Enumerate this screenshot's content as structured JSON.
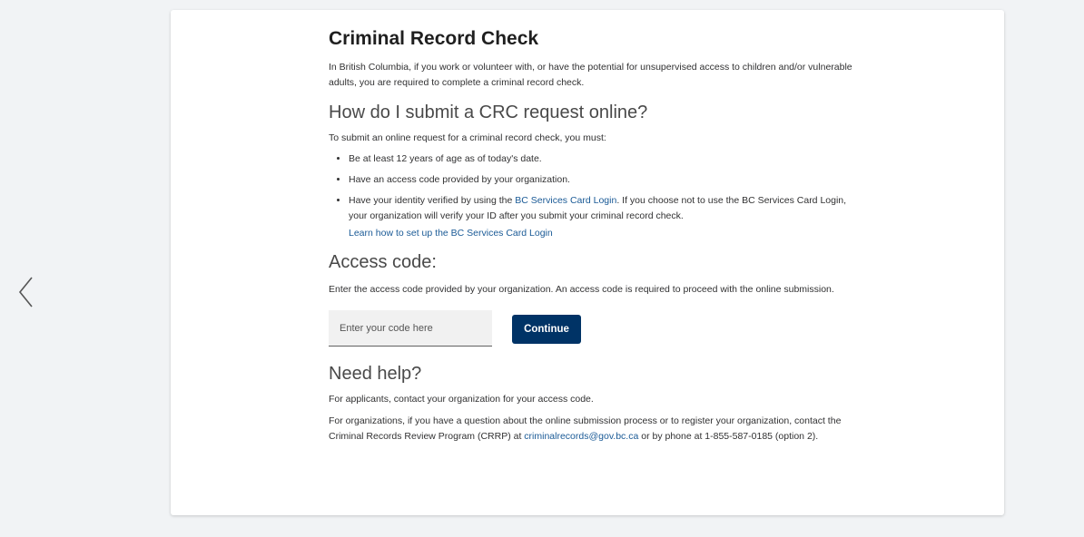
{
  "nav": {
    "back_icon": "chevron-left-icon"
  },
  "header": {
    "title": "Criminal Record Check",
    "intro": "In British Columbia, if you work or volunteer with, or have the potential for unsupervised access to children and/or vulnerable adults, you are required to complete a criminal record check."
  },
  "submit_section": {
    "heading": "How do I submit a CRC request online?",
    "intro": "To submit an online request for a criminal record check, you must:",
    "item1": "Be at least 12 years of age as of today's date.",
    "item2": "Have an access code provided by your organization.",
    "item3_before": "Have your identity verified by using the ",
    "item3_link": "BC Services Card Login",
    "item3_after": ". If you choose not to use the BC Services Card Login, your organization will verify your ID after you submit your criminal record check.",
    "learn_link": "Learn how to set up the BC Services Card Login"
  },
  "access_section": {
    "heading": "Access code:",
    "description": "Enter the access code provided by your organization. An access code is required to proceed with the online submission.",
    "input_placeholder": "Enter your code here",
    "input_value": "",
    "continue_label": "Continue"
  },
  "help_section": {
    "heading": "Need help?",
    "applicants_text": "For applicants, contact your organization for your access code.",
    "org_text_before": "For organizations, if you have a question about the online submission process or to register your organization, contact the Criminal Records Review Program (CRRP) at ",
    "email_link": "criminalrecords@gov.bc.ca",
    "org_text_after": " or by phone at 1-855-587-0185 (option 2)."
  },
  "colors": {
    "primary_button": "#003366",
    "link": "#1a5a96",
    "page_background": "#f1f3f5"
  }
}
